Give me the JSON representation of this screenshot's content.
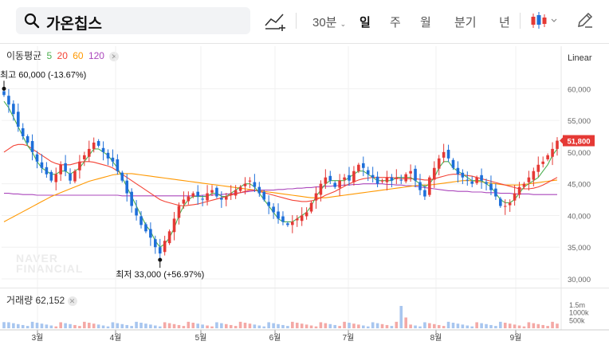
{
  "header": {
    "stock_name": "가온칩스",
    "period_tabs": [
      "30분",
      "일",
      "주",
      "월",
      "분기",
      "년"
    ],
    "active_tab": "일"
  },
  "ma_legend": {
    "label": "이동평균",
    "periods": [
      {
        "label": "5",
        "color": "#4caf50"
      },
      {
        "label": "20",
        "color": "#f44336"
      },
      {
        "label": "60",
        "color": "#ff9800"
      },
      {
        "label": "120",
        "color": "#ab47bc"
      }
    ]
  },
  "scale_type": "Linear",
  "price_axis_labels": [
    "60,000",
    "55,000",
    "50,000",
    "45,000",
    "40,000",
    "35,000",
    "30,000"
  ],
  "current_price_label": "51,800",
  "high_annotation": "최고 60,000 (-13.67%)",
  "low_annotation": "최저 33,000 (+56.97%)",
  "volume": {
    "label": "거래량",
    "value": "62,152",
    "axis_labels": [
      "1.5m",
      "1000k",
      "500k"
    ]
  },
  "watermark": [
    "NAVER",
    "FINANCIAL"
  ],
  "colors": {
    "up": "#e53935",
    "down": "#1e6fd9",
    "ma5": "#4caf50",
    "ma20": "#f44336",
    "ma60": "#ff9800",
    "ma120": "#ab47bc"
  },
  "chart_data": {
    "type": "candlestick",
    "x_labels": [
      "3월",
      "4월",
      "5월",
      "6월",
      "7월",
      "8월",
      "9월"
    ],
    "ylim": [
      30000,
      62000
    ],
    "close_series_approx": [
      59000,
      57500,
      56000,
      54000,
      52500,
      51500,
      50000,
      48500,
      47500,
      46500,
      45500,
      46500,
      48000,
      47000,
      45500,
      47000,
      48500,
      49500,
      50500,
      51500,
      51000,
      50000,
      49000,
      48500,
      47000,
      45500,
      43500,
      41500,
      40000,
      38500,
      37500,
      36500,
      35000,
      34000,
      36000,
      37500,
      39500,
      41500,
      42500,
      43000,
      43500,
      43000,
      42500,
      43500,
      44000,
      43000,
      42500,
      43000,
      43500,
      44000,
      44500,
      45000,
      45500,
      44500,
      43500,
      42500,
      41500,
      40500,
      39500,
      39000,
      38500,
      39000,
      39500,
      40000,
      40500,
      42000,
      43500,
      45000,
      46000,
      45500,
      44500,
      45500,
      46000,
      45500,
      47000,
      48000,
      47500,
      46500,
      46000,
      45000,
      45500,
      46000,
      45500,
      46000,
      45500,
      46500,
      47000,
      45500,
      44000,
      43000,
      46000,
      47500,
      49000,
      50000,
      49000,
      47500,
      46500,
      46000,
      45500,
      45000,
      46000,
      45500,
      45000,
      44000,
      43000,
      41500,
      41500,
      42000,
      43500,
      44500,
      45000,
      46000,
      47000,
      48000,
      48500,
      49500,
      50500,
      51800
    ],
    "ma5_approx": [
      58000,
      57000,
      55500,
      54000,
      52500,
      51000,
      50000,
      48500,
      47500,
      47000,
      46500,
      46500,
      47000,
      47000,
      46500,
      47000,
      47500,
      48500,
      49500,
      50500,
      50500,
      50000,
      49500,
      48500,
      47500,
      46000,
      44500,
      43000,
      41500,
      40000,
      38500,
      37500,
      36000,
      35000,
      35500,
      36500,
      38000,
      40000,
      41500,
      42500,
      43000,
      43000,
      43000,
      43000,
      43500,
      43500,
      43000,
      43000,
      43500,
      44000,
      44500,
      45000,
      45000,
      44500,
      43500,
      42500,
      41500,
      40500,
      39500,
      39000,
      39000,
      39000,
      39500,
      40000,
      40500,
      41500,
      43000,
      44000,
      45000,
      45500,
      45500,
      45500,
      45500,
      46000,
      46500,
      47000,
      47000,
      46500,
      46000,
      45500,
      45500,
      45500,
      45500,
      46000,
      46000,
      46000,
      46000,
      45500,
      45000,
      44500,
      45000,
      46000,
      47500,
      48500,
      48500,
      47500,
      47000,
      46500,
      46000,
      45500,
      45500,
      45500,
      45000,
      44500,
      43500,
      42500,
      42000,
      42000,
      42500,
      43500,
      44500,
      45000,
      45500,
      46000,
      47000,
      48000,
      49500,
      50500
    ],
    "ma20_approx": [
      50000,
      50500,
      51000,
      51200,
      51200,
      51000,
      50500,
      50000,
      49500,
      49000,
      48500,
      48200,
      48000,
      48000,
      48000,
      48200,
      48400,
      48500,
      48500,
      48400,
      48200,
      48000,
      47800,
      47500,
      47000,
      46500,
      46000,
      45500,
      45000,
      44500,
      44000,
      43500,
      43000,
      42500,
      42200,
      42000,
      41800,
      41600,
      41500,
      41600,
      41700,
      41800,
      42000,
      42200,
      42400,
      42600,
      42800,
      43000,
      43200,
      43400,
      43600,
      43800,
      44000,
      44000,
      43800,
      43600,
      43400,
      43200,
      43000,
      42800,
      42600,
      42400,
      42300,
      42200,
      42200,
      42300,
      42500,
      42800,
      43200,
      43500,
      43800,
      44200,
      44600,
      45000,
      45300,
      45600,
      45800,
      45900,
      46000,
      46000,
      46000,
      46000,
      46000,
      45900,
      45800,
      45800,
      45800,
      45800,
      45700,
      45600,
      45600,
      45800,
      46000,
      46200,
      46400,
      46500,
      46500,
      46400,
      46300,
      46200,
      46000,
      45800,
      45600,
      45400,
      45200,
      45000,
      44800,
      44600,
      44400,
      44200,
      44200,
      44200,
      44300,
      44500,
      44800,
      45200,
      45600,
      46000
    ],
    "ma60_approx": [
      39000,
      39400,
      39800,
      40200,
      40600,
      41000,
      41400,
      41800,
      42200,
      42600,
      43000,
      43300,
      43600,
      43900,
      44200,
      44500,
      44800,
      45100,
      45400,
      45600,
      45800,
      46000,
      46200,
      46400,
      46500,
      46600,
      46600,
      46600,
      46500,
      46400,
      46300,
      46200,
      46100,
      46000,
      45900,
      45800,
      45700,
      45600,
      45500,
      45400,
      45300,
      45200,
      45100,
      45000,
      44900,
      44800,
      44700,
      44600,
      44500,
      44400,
      44300,
      44200,
      44100,
      44000,
      43900,
      43800,
      43700,
      43600,
      43500,
      43400,
      43300,
      43200,
      43100,
      43000,
      42900,
      42800,
      42800,
      42800,
      42800,
      42900,
      43000,
      43100,
      43200,
      43300,
      43400,
      43500,
      43600,
      43700,
      43800,
      43900,
      44000,
      44100,
      44200,
      44300,
      44400,
      44500,
      44600,
      44700,
      44800,
      44800,
      44800,
      44900,
      45000,
      45100,
      45200,
      45300,
      45400,
      45500,
      45500,
      45500,
      45400,
      45300,
      45200,
      45100,
      45000,
      44900,
      44800,
      44800,
      44800,
      44800,
      44900,
      45000,
      45100,
      45200,
      45300,
      45400,
      45500,
      45600
    ],
    "ma120_approx": [
      43500,
      43500,
      43400,
      43400,
      43300,
      43300,
      43300,
      43200,
      43200,
      43200,
      43200,
      43200,
      43200,
      43200,
      43200,
      43200,
      43200,
      43200,
      43200,
      43200,
      43200,
      43200,
      43200,
      43200,
      43200,
      43100,
      43100,
      43100,
      43100,
      43100,
      43100,
      43100,
      43100,
      43100,
      43100,
      43100,
      43100,
      43100,
      43100,
      43100,
      43100,
      43100,
      43200,
      43200,
      43200,
      43300,
      43300,
      43400,
      43400,
      43500,
      43600,
      43700,
      43800,
      43900,
      44000,
      44000,
      44000,
      44000,
      44100,
      44100,
      44200,
      44200,
      44300,
      44300,
      44400,
      44400,
      44500,
      44500,
      44600,
      44600,
      44700,
      44700,
      44800,
      44800,
      44900,
      44900,
      45000,
      45000,
      45000,
      45000,
      45000,
      44900,
      44900,
      44800,
      44800,
      44700,
      44700,
      44600,
      44500,
      44400,
      44300,
      44200,
      44100,
      44000,
      43900,
      43900,
      43800,
      43800,
      43800,
      43700,
      43700,
      43700,
      43600,
      43600,
      43600,
      43500,
      43500,
      43500,
      43400,
      43400,
      43400,
      43400,
      43300,
      43300,
      43300,
      43300,
      43300,
      43300
    ],
    "high": 60000,
    "low": 33000,
    "volume_ylim": [
      0,
      1500000
    ]
  }
}
